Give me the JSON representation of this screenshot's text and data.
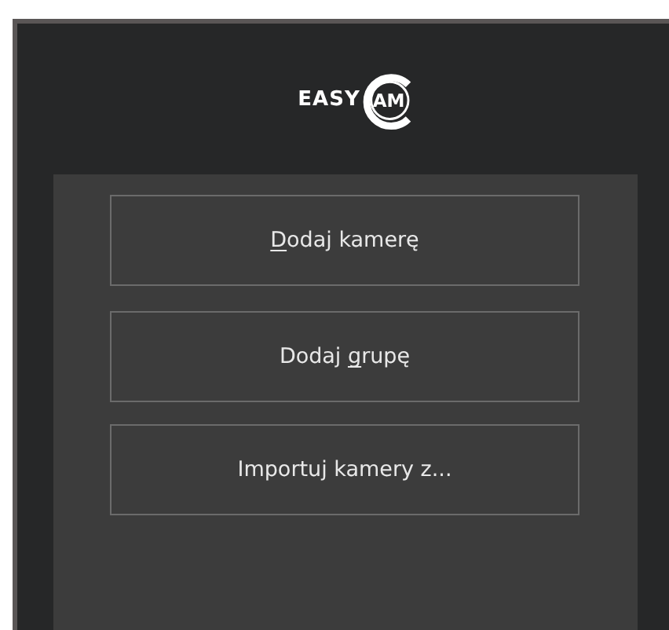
{
  "logo": {
    "word": "EASY",
    "badge": "AM"
  },
  "buttons": [
    {
      "segments": [
        {
          "text": "D",
          "underline": true
        },
        {
          "text": "odaj kamerę",
          "underline": false
        }
      ]
    },
    {
      "segments": [
        {
          "text": "Dodaj ",
          "underline": false
        },
        {
          "text": "g",
          "underline": true
        },
        {
          "text": "rupę",
          "underline": false
        }
      ]
    },
    {
      "segments": [
        {
          "text": "Importuj kamery z...",
          "underline": false
        }
      ]
    }
  ]
}
